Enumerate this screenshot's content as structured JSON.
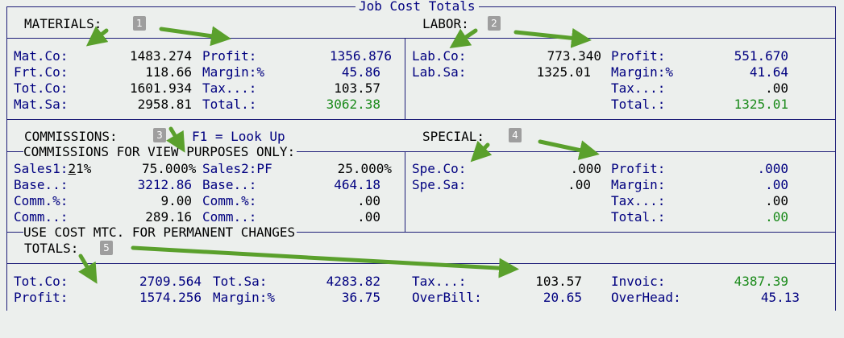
{
  "window": {
    "title": "Job Cost Totals"
  },
  "sections": {
    "materials": {
      "label": "MATERIALS:",
      "badge": "1"
    },
    "labor": {
      "label": "LABOR:",
      "badge": "2"
    },
    "commissions": {
      "label": "COMMISSIONS:",
      "badge": "3",
      "hint": "F1 = Look Up",
      "subtitle": "COMMISSIONS FOR VIEW PURPOSES ONLY:"
    },
    "special": {
      "label": "SPECIAL:",
      "badge": "4"
    },
    "totals": {
      "label": "TOTALS:",
      "badge": "5",
      "note": "USE COST MTC. FOR PERMANENT CHANGES"
    }
  },
  "materials": {
    "left": [
      {
        "label": "Mat.Co:",
        "value": "1483.274"
      },
      {
        "label": "Frt.Co:",
        "value": "118.66"
      },
      {
        "label": "Tot.Co:",
        "value": "1601.934"
      },
      {
        "label": "Mat.Sa:",
        "value": "2958.81"
      }
    ],
    "right": [
      {
        "label": "Profit:",
        "value": "1356.876"
      },
      {
        "label": "Margin:%",
        "value": "45.86"
      },
      {
        "label": "Tax...:",
        "value": "103.57"
      },
      {
        "label": "Total.:",
        "value": "3062.38"
      }
    ]
  },
  "labor": {
    "left": [
      {
        "label": "Lab.Co:",
        "value": "773.340"
      },
      {
        "label": "Lab.Sa:",
        "value": "1325.01"
      }
    ],
    "right": [
      {
        "label": "Profit:",
        "value": "551.670"
      },
      {
        "label": "Margin:%",
        "value": "41.64"
      },
      {
        "label": "Tax...:",
        "value": ".00"
      },
      {
        "label": "Total.:",
        "value": "1325.01"
      }
    ]
  },
  "commissions": {
    "sales1": {
      "label_pre": "Sales1:",
      "code_first": "2",
      "code_rest": "1%",
      "value": "75.000%"
    },
    "sales2": {
      "label": "Sales2:PF",
      "value": "25.000%"
    },
    "left": [
      {
        "label": "Base..:",
        "value": "3212.86"
      },
      {
        "label": "Comm.%:",
        "value": "9.00"
      },
      {
        "label": "Comm..:",
        "value": "289.16"
      }
    ],
    "right": [
      {
        "label": "Base..:",
        "value": "464.18"
      },
      {
        "label": "Comm.%:",
        "value": ".00"
      },
      {
        "label": "Comm..:",
        "value": ".00"
      }
    ]
  },
  "special": {
    "left": [
      {
        "label": "Spe.Co:",
        "value": ".000"
      },
      {
        "label": "Spe.Sa:",
        "value": ".00"
      }
    ],
    "right": [
      {
        "label": "Profit:",
        "value": ".000"
      },
      {
        "label": "Margin:",
        "value": ".00"
      },
      {
        "label": "Tax...:",
        "value": ".00"
      },
      {
        "label": "Total.:",
        "value": ".00"
      }
    ]
  },
  "totals": {
    "row1": [
      {
        "label": "Tot.Co:",
        "value": "2709.564"
      },
      {
        "label": "Tot.Sa:",
        "value": "4283.82"
      },
      {
        "label": "Tax...:",
        "value": "103.57"
      },
      {
        "label": "Invoic:",
        "value": "4387.39"
      }
    ],
    "row2": [
      {
        "label": "Profit:",
        "value": "1574.256"
      },
      {
        "label": "Margin:%",
        "value": "36.75"
      },
      {
        "label": "OverBill:",
        "value": "20.65"
      },
      {
        "label": "OverHead:",
        "value": "45.13"
      }
    ]
  },
  "colors": {
    "text": "#000080",
    "total_value": "#1a8a1a",
    "arrow": "#5aa02c",
    "border": "#1e1e78"
  }
}
